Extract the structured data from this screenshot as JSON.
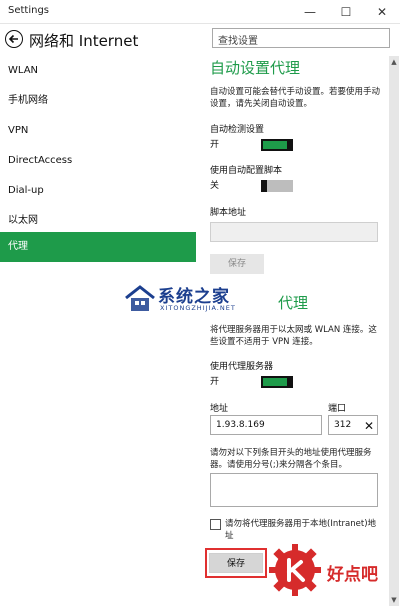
{
  "window": {
    "title": "Settings",
    "minimize": "—",
    "maximize": "☐",
    "close": "✕"
  },
  "header": {
    "title": "网络和 Internet",
    "search_placeholder": "查找设置"
  },
  "sidebar": {
    "items": [
      {
        "label": "WLAN"
      },
      {
        "label": "手机网络"
      },
      {
        "label": "VPN"
      },
      {
        "label": "DirectAccess"
      },
      {
        "label": "Dial-up"
      },
      {
        "label": "以太网"
      },
      {
        "label": "代理"
      }
    ],
    "active_index": 6
  },
  "auto_proxy": {
    "heading": "自动设置代理",
    "description": "自动设置可能会替代手动设置。若要使用手动设置，请先关闭自动设置。",
    "detect_label": "自动检测设置",
    "detect_state": "开",
    "script_label": "使用自动配置脚本",
    "script_state": "关",
    "address_label": "脚本地址",
    "address_value": "",
    "save_label": "保存"
  },
  "manual_proxy": {
    "heading": "代理",
    "description": "将代理服务器用于以太网或 WLAN 连接。这些设置不适用于 VPN 连接。",
    "use_label": "使用代理服务器",
    "use_state": "开",
    "address_label": "地址",
    "address_value": "1.93.8.169",
    "port_label": "端口",
    "port_value": "312",
    "exceptions_desc": "请勿对以下列条目开头的地址使用代理服务器。请使用分号(;)来分隔各个条目。",
    "exceptions_value": "",
    "local_checkbox_label": "请勿将代理服务器用于本地(Intranet)地址",
    "local_checked": false,
    "save_label": "保存"
  },
  "watermarks": {
    "site1_name": "系统之家",
    "site1_url": "XITONGZHIJIA.NET",
    "site2_name": "好点吧"
  },
  "colors": {
    "accent": "#1e9b4a",
    "highlight": "#e03030"
  }
}
